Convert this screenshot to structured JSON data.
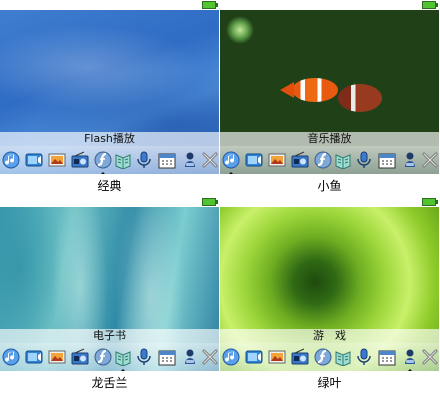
{
  "dock_icons": [
    "music-icon",
    "video-icon",
    "photo-icon",
    "radio-icon",
    "flash-icon",
    "ebook-icon",
    "recorder-icon",
    "calendar-icon",
    "game-icon",
    "settings-icon"
  ],
  "cells": [
    {
      "app_title": "Flash播放",
      "caption": "经典",
      "selected_icon": 4
    },
    {
      "app_title": "音乐播放",
      "caption": "小鱼",
      "selected_icon": 0
    },
    {
      "app_title": "电子书",
      "caption": "龙舌兰",
      "selected_icon": 5
    },
    {
      "app_title": "游　戏",
      "caption": "绿叶",
      "selected_icon": 8
    }
  ]
}
